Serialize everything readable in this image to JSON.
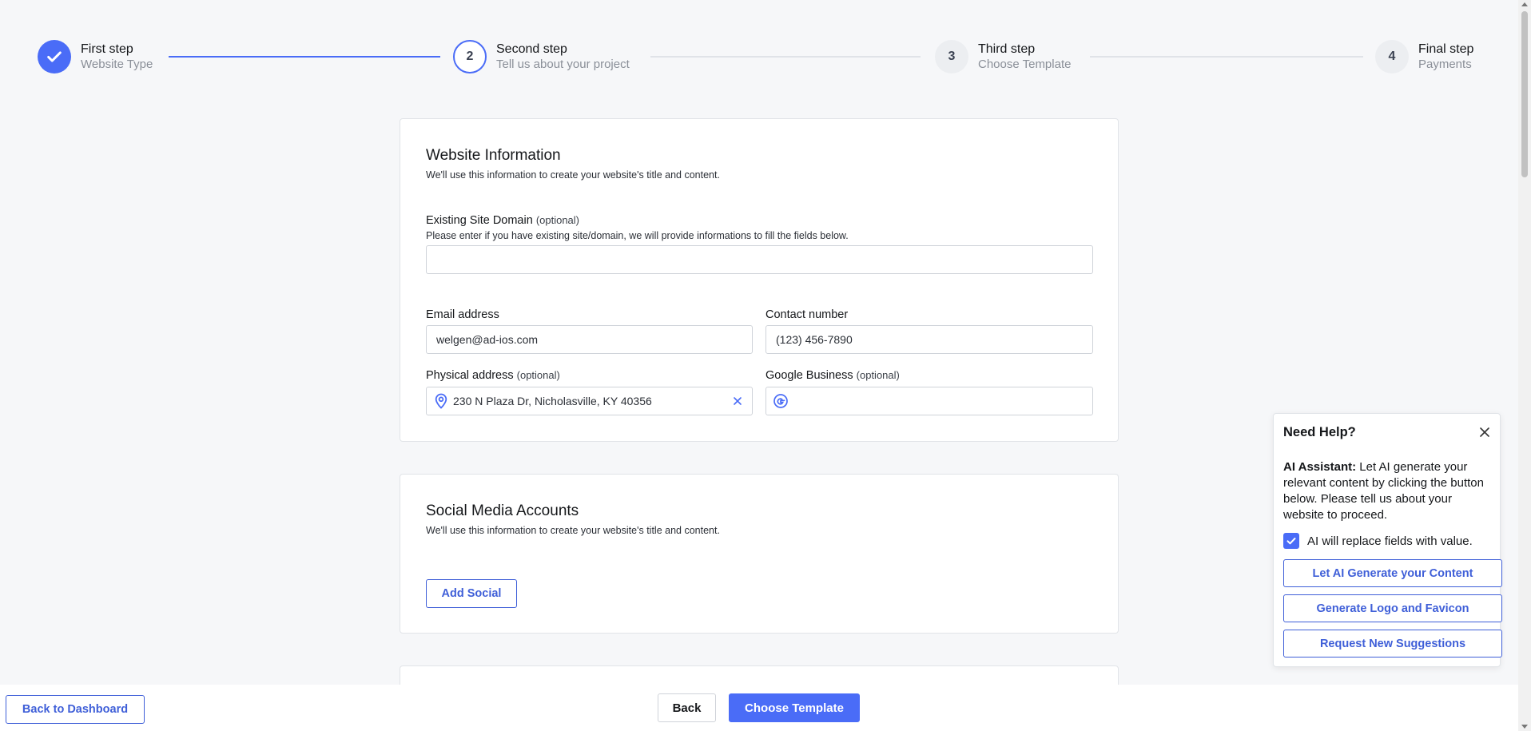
{
  "stepper": {
    "steps": [
      {
        "number": "",
        "title": "First step",
        "subtitle": "Website Type",
        "status": "done"
      },
      {
        "number": "2",
        "title": "Second step",
        "subtitle": "Tell us about your project",
        "status": "active"
      },
      {
        "number": "3",
        "title": "Third step",
        "subtitle": "Choose Template",
        "status": "pending"
      },
      {
        "number": "4",
        "title": "Final step",
        "subtitle": "Payments",
        "status": "pending"
      }
    ]
  },
  "website_info": {
    "title": "Website Information",
    "description": "We'll use this information to create your website's title and content.",
    "domain_label": "Existing Site Domain",
    "optional": "(optional)",
    "domain_help": "Please enter if you have existing site/domain, we will provide informations to fill the fields below.",
    "domain_value": "",
    "email_label": "Email address",
    "email_value": "welgen@ad-ios.com",
    "contact_label": "Contact number",
    "contact_value": "(123) 456-7890",
    "address_label": "Physical address",
    "address_value": "230 N Plaza Dr, Nicholasville, KY 40356",
    "google_label": "Google Business",
    "google_value": ""
  },
  "social": {
    "title": "Social Media Accounts",
    "description": "We'll use this information to create your website's title and content.",
    "add_button": "Add Social"
  },
  "help_panel": {
    "title": "Need Help?",
    "ai_label": "AI Assistant:",
    "ai_text": " Let AI generate your relevant content by clicking the button below. Please tell us about your website to proceed.",
    "checkbox_label": "AI will replace fields with value.",
    "checkbox_checked": true,
    "buttons": [
      "Let AI Generate your Content",
      "Generate Logo and Favicon",
      "Request New Suggestions"
    ]
  },
  "footer": {
    "back_dashboard": "Back to Dashboard",
    "back": "Back",
    "choose_template": "Choose Template"
  },
  "colors": {
    "accent": "#4a6cf7",
    "background": "#f6f7f9"
  }
}
